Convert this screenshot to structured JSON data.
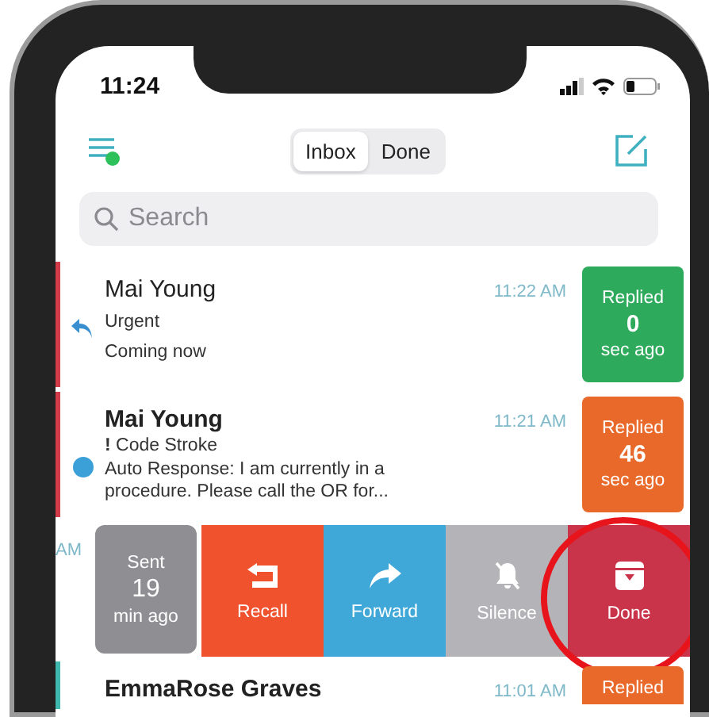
{
  "status_bar": {
    "time": "11:24"
  },
  "header": {
    "menu_notification": true,
    "tabs": [
      {
        "label": "Inbox",
        "selected": true
      },
      {
        "label": "Done",
        "selected": false
      }
    ]
  },
  "search": {
    "placeholder": "Search"
  },
  "messages": [
    {
      "kind": "message",
      "sender": "Mai Young",
      "time": "11:22 AM",
      "subject": "Urgent",
      "preview": "Coming now",
      "unread": false,
      "replied": true,
      "new": false,
      "color": "#d23c4a",
      "badge": {
        "top": "Replied",
        "count": "0",
        "bottom": "sec ago",
        "color": "#2eaa5c"
      }
    },
    {
      "kind": "message",
      "sender": "Mai Young",
      "time": "11:21 AM",
      "subject": "**!** Code Stroke",
      "preview": "Auto Response: I am currently in a procedure. Please call the OR for...",
      "unread": true,
      "replied": false,
      "new": true,
      "color": "#d23c4a",
      "badge": {
        "top": "Replied",
        "count": "46",
        "bottom": "sec ago",
        "color": "#e8692a"
      }
    },
    {
      "kind": "swiped",
      "time": "AM",
      "badge": {
        "top": "Sent",
        "count": "19",
        "bottom": "min ago",
        "color": "#8e8e93"
      },
      "actions": [
        {
          "label": "Recall",
          "kind": "recall",
          "color": "#f0522e",
          "highlighted": false
        },
        {
          "label": "Forward",
          "kind": "forward",
          "color": "#3fa8d8",
          "highlighted": false
        },
        {
          "label": "Silence",
          "kind": "silence",
          "color": "#b4b4b8",
          "highlighted": false
        },
        {
          "label": "Done",
          "kind": "done",
          "color": "#c9344a",
          "highlighted": true
        }
      ]
    },
    {
      "kind": "message",
      "sender": "EmmaRose Graves",
      "time": "11:01 AM",
      "unread": true,
      "color": "#3fb8b0",
      "badge": {
        "top": "Replied",
        "color": "#e8692a"
      }
    }
  ]
}
